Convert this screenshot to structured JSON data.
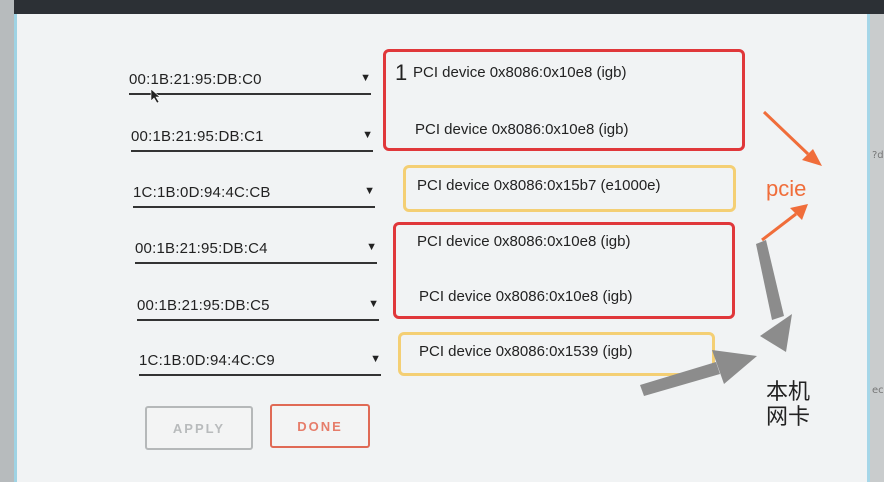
{
  "colors": {
    "frame_dark": "#2c3035",
    "panel": "#f1f3f4",
    "red_box": "#e0373a",
    "yellow_box": "#f4cf74",
    "orange_arrow": "#f06d3a",
    "gray_arrow": "#8a8a8a"
  },
  "interfaces": [
    {
      "mac": "00:1B:21:95:DB:C0",
      "device": "PCI device 0x8086:0x10e8 (igb)"
    },
    {
      "mac": "00:1B:21:95:DB:C1",
      "device": "PCI device 0x8086:0x10e8 (igb)"
    },
    {
      "mac": "1C:1B:0D:94:4C:CB",
      "device": "PCI device 0x8086:0x15b7 (e1000e)"
    },
    {
      "mac": "00:1B:21:95:DB:C4",
      "device": "PCI device 0x8086:0x10e8 (igb)"
    },
    {
      "mac": "00:1B:21:95:DB:C5",
      "device": "PCI device 0x8086:0x10e8 (igb)"
    },
    {
      "mac": "1C:1B:0D:94:4C:C9",
      "device": "PCI device 0x8086:0x1539 (igb)"
    }
  ],
  "buttons": {
    "apply": "APPLY",
    "done": "DONE"
  },
  "annotations": {
    "number_one": "1",
    "pcie": "pcie",
    "onboard_line1": "本机",
    "onboard_line2": "网卡"
  },
  "icons": {
    "dropdown": "triangle-down-icon",
    "cursor": "mouse-pointer-icon"
  },
  "edge_fragments": {
    "right_top": "?d",
    "right_bottom": "ec"
  }
}
